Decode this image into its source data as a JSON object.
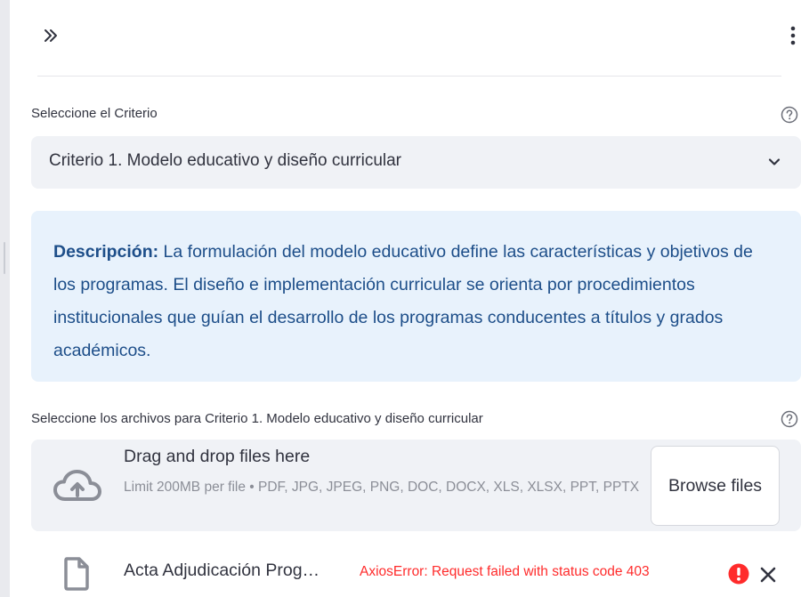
{
  "header": {
    "expand_icon": "double-chevron-right-icon",
    "menu_icon": "vertical-ellipsis-icon"
  },
  "criterion_select": {
    "label": "Seleccione el Criterio",
    "value": "Criterio 1. Modelo educativo y diseño curricular",
    "help_icon": "question-circle-icon",
    "chevron_icon": "chevron-down-icon"
  },
  "info_box": {
    "bold_label": "Descripción:",
    "text": " La formulación del modelo educativo define las características y objetivos de los programas. El diseño e implementación curricular se orienta por procedimientos institucionales que guían el desarrollo de los programas conducentes a títulos y grados académicos."
  },
  "uploader": {
    "label": "Seleccione los archivos para Criterio 1. Modelo educativo y diseño curricular",
    "help_icon": "question-circle-icon",
    "drop_title": "Drag and drop files here",
    "drop_limits": "Limit 200MB per file • PDF, JPG, JPEG, PNG, DOC, DOCX, XLS, XLSX, PPT, PPTX",
    "browse_label": "Browse files",
    "cloud_icon": "cloud-upload-icon"
  },
  "uploaded_file": {
    "name": "Acta Adjudicación Prog…",
    "error": "AxiosError: Request failed with status code 403",
    "file_icon": "file-icon",
    "error_icon": "error-exclamation-icon",
    "remove_icon": "close-icon"
  },
  "colors": {
    "info_background": "#e8f2fc",
    "info_text": "#1d4e89",
    "error_red": "#ff2b2b",
    "input_background": "#f0f2f6"
  }
}
